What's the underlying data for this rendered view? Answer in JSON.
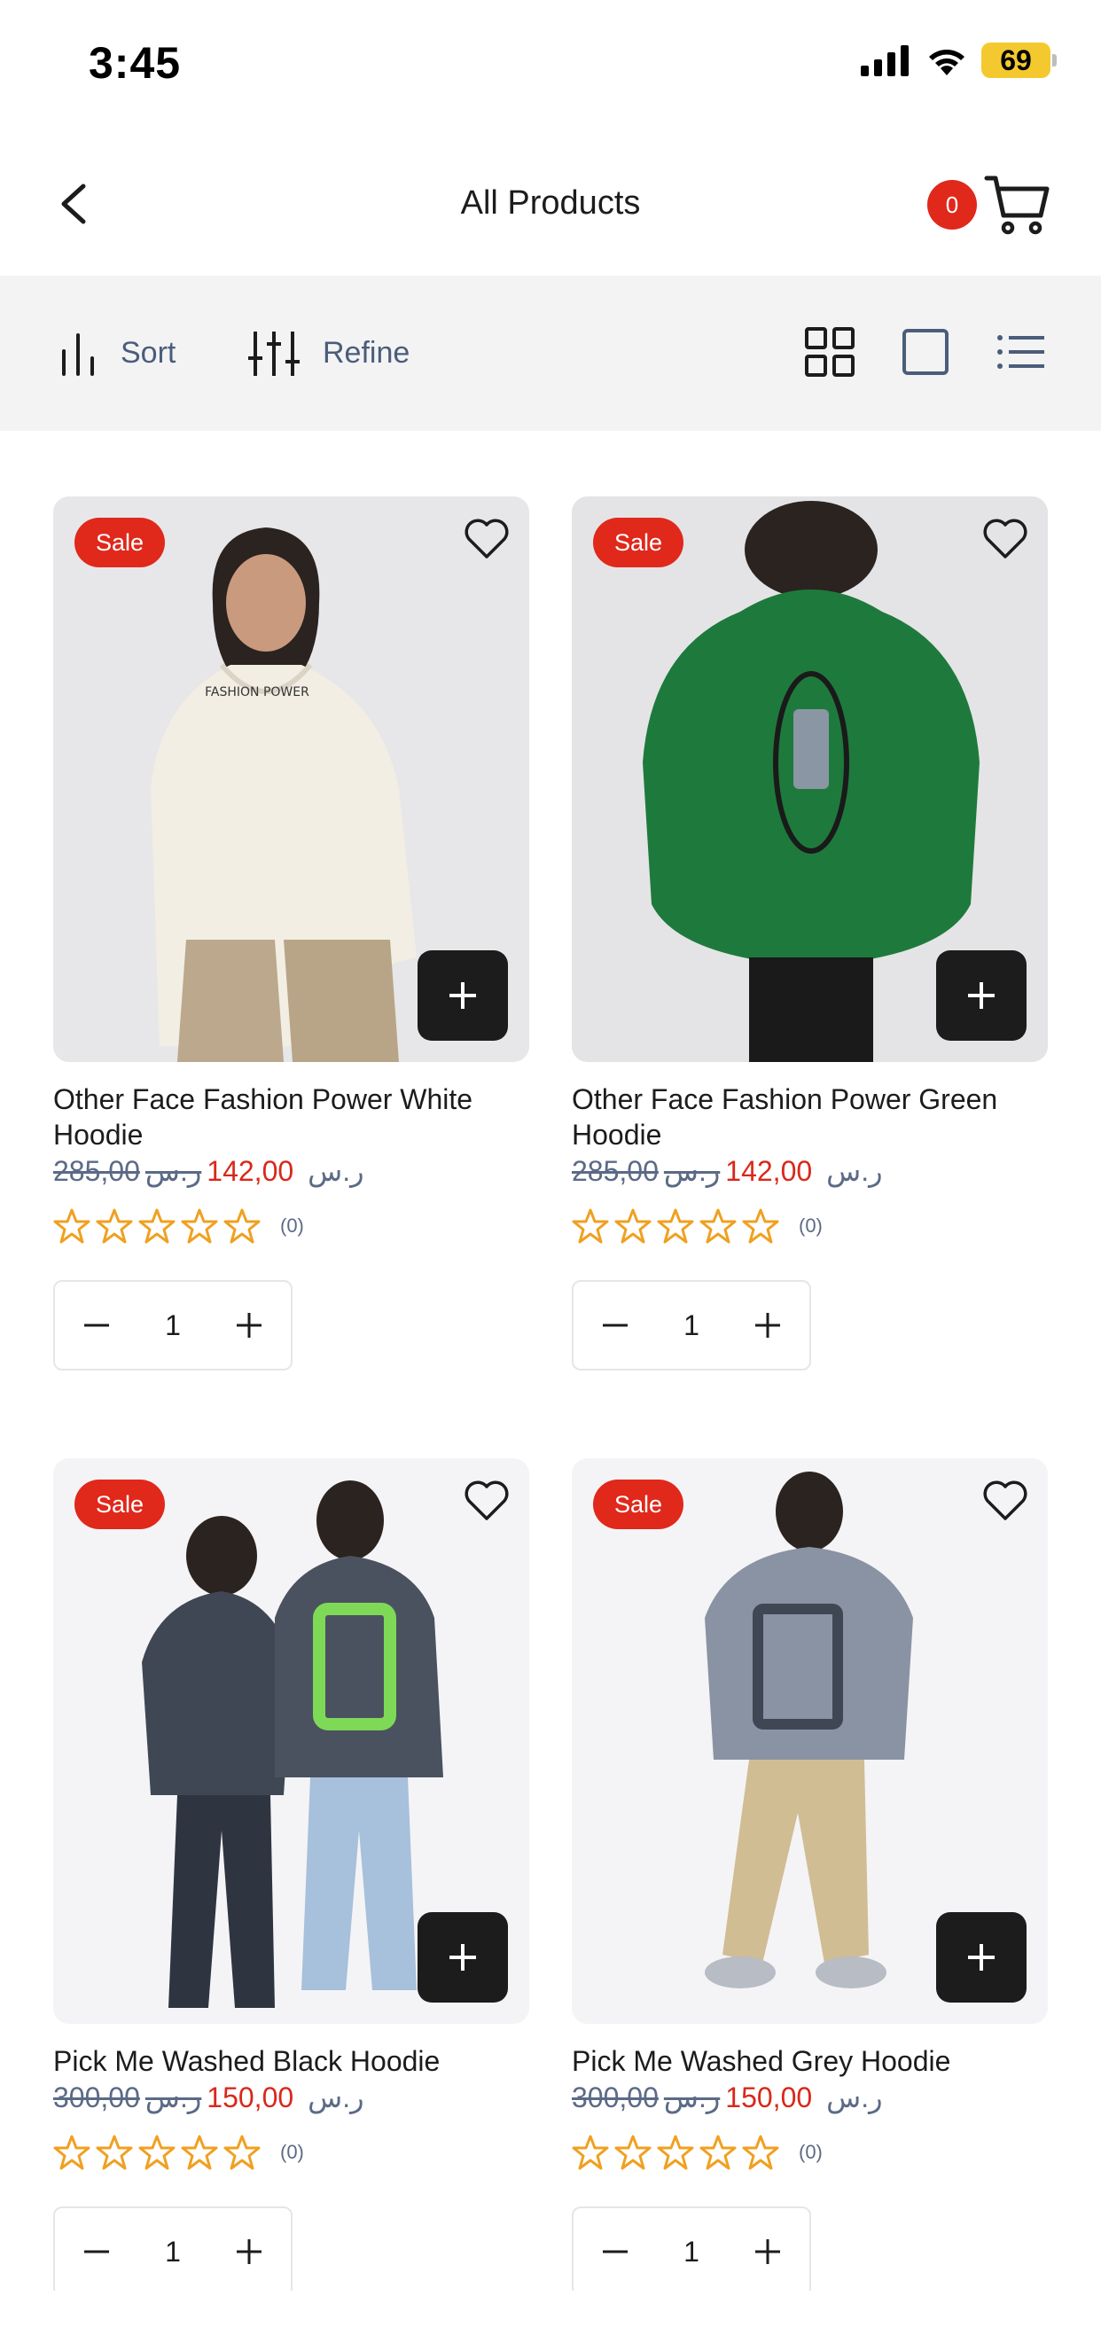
{
  "status_bar": {
    "time": "3:45",
    "battery": "69"
  },
  "header": {
    "title": "All Products",
    "cart_count": "0"
  },
  "toolbar": {
    "sort_label": "Sort",
    "refine_label": "Refine"
  },
  "products": [
    {
      "name": "Other Face Fashion Power White Hoodie",
      "badge": "Sale",
      "old_price": "285,00",
      "currency": "ر.س",
      "new_price": "142,00",
      "rating_count": "(0)",
      "quantity": "1"
    },
    {
      "name": "Other Face Fashion Power Green Hoodie",
      "badge": "Sale",
      "old_price": "285,00",
      "currency": "ر.س",
      "new_price": "142,00",
      "rating_count": "(0)",
      "quantity": "1"
    },
    {
      "name": "Pick Me Washed Black Hoodie",
      "badge": "Sale",
      "old_price": "300,00",
      "currency": "ر.س",
      "new_price": "150,00",
      "rating_count": "(0)",
      "quantity": "1"
    },
    {
      "name": "Pick Me Washed Grey Hoodie",
      "badge": "Sale",
      "old_price": "300,00",
      "currency": "ر.س",
      "new_price": "150,00",
      "rating_count": "(0)",
      "quantity": "1"
    }
  ],
  "colors": {
    "accent": "#e0281b",
    "star": "#f0a020",
    "muted": "#5b6a86"
  }
}
